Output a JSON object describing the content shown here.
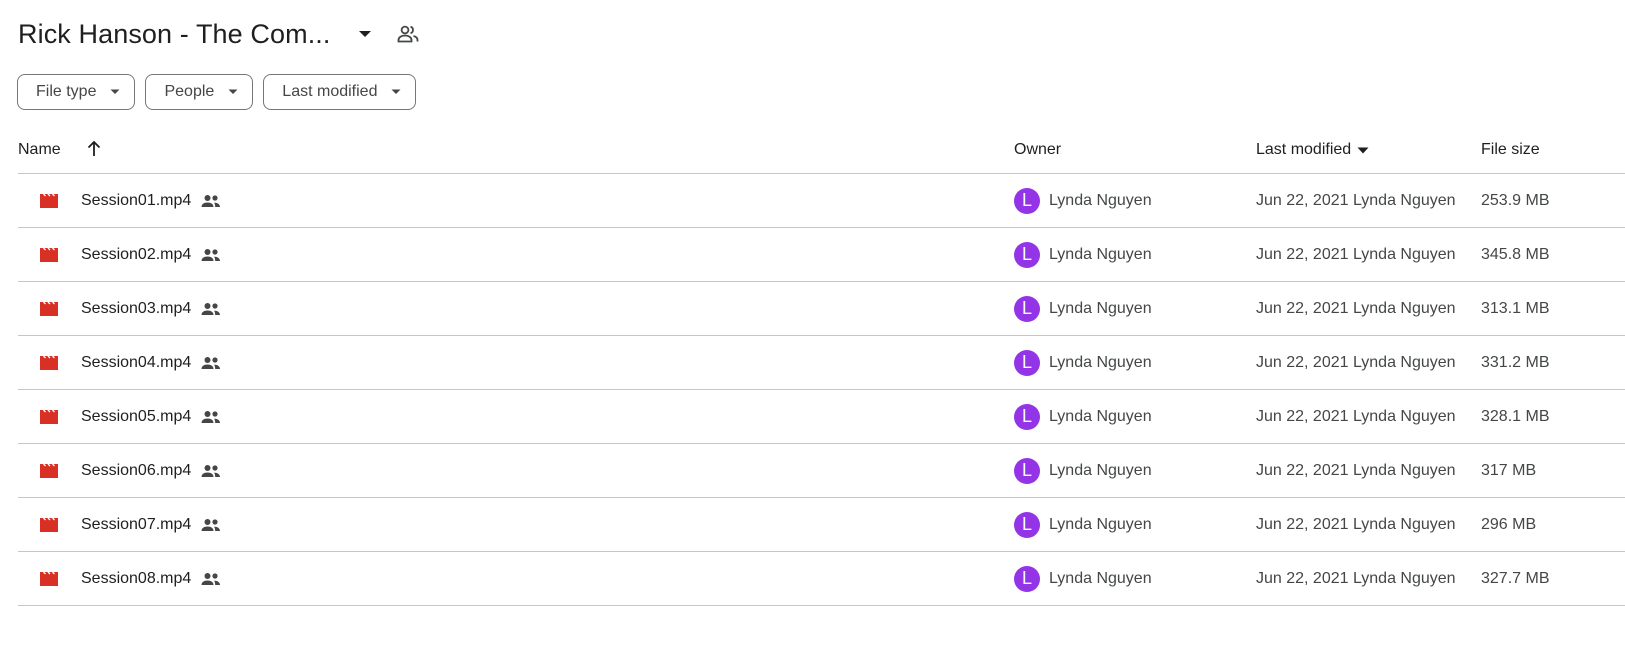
{
  "header": {
    "title": "Rick Hanson - The Com..."
  },
  "filters": [
    {
      "label": "File type"
    },
    {
      "label": "People"
    },
    {
      "label": "Last modified"
    }
  ],
  "columns": {
    "name": "Name",
    "owner": "Owner",
    "last_modified": "Last modified",
    "file_size": "File size"
  },
  "colors": {
    "avatar": "#9334e6",
    "video_icon": "#d93025"
  },
  "files": [
    {
      "name": "Session01.mp4",
      "owner_initial": "L",
      "owner": "Lynda Nguyen",
      "modified": "Jun 22, 2021 Lynda Nguyen",
      "size": "253.9 MB"
    },
    {
      "name": "Session02.mp4",
      "owner_initial": "L",
      "owner": "Lynda Nguyen",
      "modified": "Jun 22, 2021 Lynda Nguyen",
      "size": "345.8 MB"
    },
    {
      "name": "Session03.mp4",
      "owner_initial": "L",
      "owner": "Lynda Nguyen",
      "modified": "Jun 22, 2021 Lynda Nguyen",
      "size": "313.1 MB"
    },
    {
      "name": "Session04.mp4",
      "owner_initial": "L",
      "owner": "Lynda Nguyen",
      "modified": "Jun 22, 2021 Lynda Nguyen",
      "size": "331.2 MB"
    },
    {
      "name": "Session05.mp4",
      "owner_initial": "L",
      "owner": "Lynda Nguyen",
      "modified": "Jun 22, 2021 Lynda Nguyen",
      "size": "328.1 MB"
    },
    {
      "name": "Session06.mp4",
      "owner_initial": "L",
      "owner": "Lynda Nguyen",
      "modified": "Jun 22, 2021 Lynda Nguyen",
      "size": "317 MB"
    },
    {
      "name": "Session07.mp4",
      "owner_initial": "L",
      "owner": "Lynda Nguyen",
      "modified": "Jun 22, 2021 Lynda Nguyen",
      "size": "296 MB"
    },
    {
      "name": "Session08.mp4",
      "owner_initial": "L",
      "owner": "Lynda Nguyen",
      "modified": "Jun 22, 2021 Lynda Nguyen",
      "size": "327.7 MB"
    }
  ]
}
